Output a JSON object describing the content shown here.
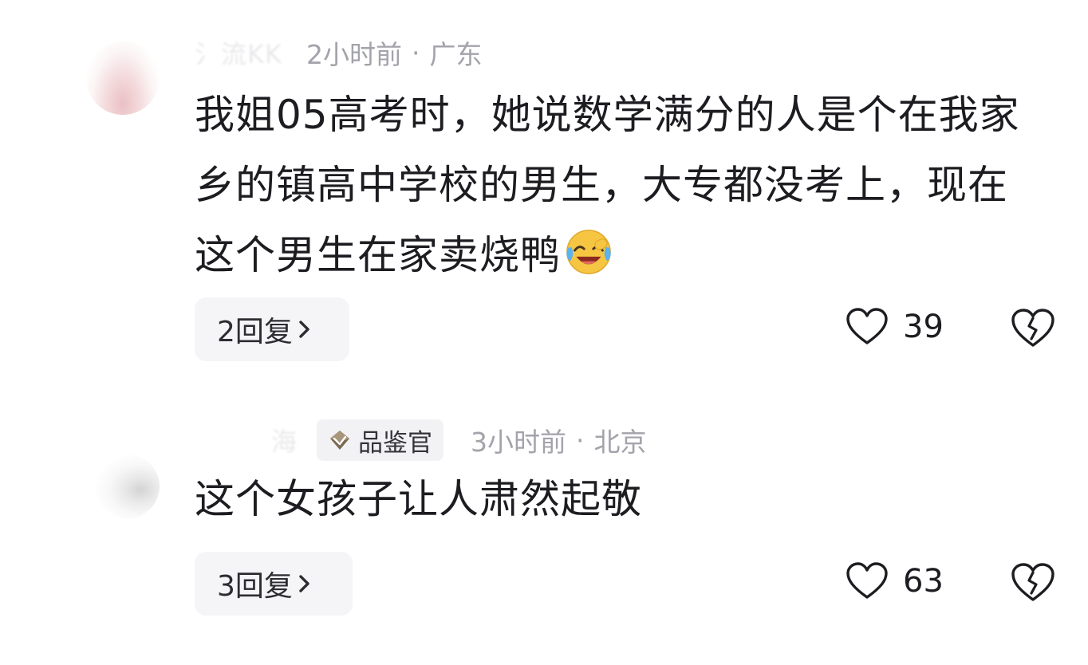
{
  "comments": [
    {
      "username": "氵流KK",
      "badge": "",
      "time": "2小时前",
      "separator": "·",
      "location": "广东",
      "text": "我姐05高考时，她说数学满分的人是个在我家乡的镇高中学校的男生，大专都没考上，现在这个男生在家卖烧鸭",
      "emoji_icon": "laughing-crying-emoji",
      "reply_label": "2回复",
      "like_count": "39",
      "icons": [
        "heart-icon",
        "broken-heart-icon",
        "chevron-right-icon"
      ]
    },
    {
      "username": "海",
      "badge": "品鉴官",
      "time": "3小时前",
      "separator": "·",
      "location": "北京",
      "text": "这个女孩子让人肃然起敬",
      "reply_label": "3回复",
      "like_count": "63",
      "icons": [
        "heart-icon",
        "broken-heart-icon",
        "chevron-right-icon",
        "badge-diamond-icon"
      ]
    }
  ],
  "colors": {
    "text_primary": "#1c1c21",
    "text_meta": "#a3a3ab",
    "reply_bg": "#f5f5f7",
    "badge_bg": "#f2f2f4"
  }
}
